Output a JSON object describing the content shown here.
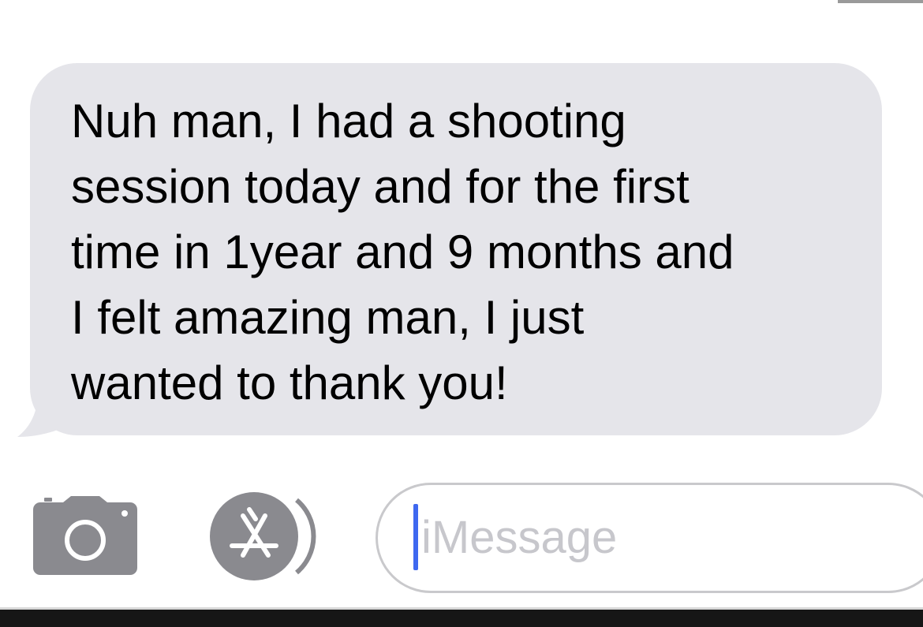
{
  "conversation": {
    "received_message": "Nuh man, I had a shooting\nsession today and for the first\ntime in 1year and 9 months and\nI felt amazing man, I just\nwanted to thank you!",
    "bubble_color": "#e5e5ea"
  },
  "input_bar": {
    "camera_icon": "camera-icon",
    "apps_icon": "app-store-icon",
    "message_placeholder": "iMessage",
    "caret_color": "#3e68f0"
  }
}
